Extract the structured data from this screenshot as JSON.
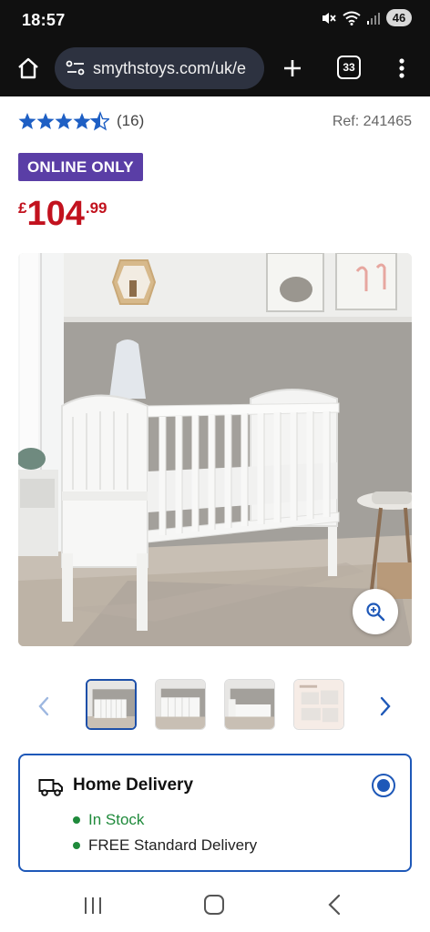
{
  "status_bar": {
    "time": "18:57",
    "battery": "46"
  },
  "browser": {
    "url": "smythstoys.com/uk/e",
    "tab_count": "33"
  },
  "product": {
    "rating": 4.5,
    "review_count": "(16)",
    "ref": "Ref: 241465",
    "badge": "ONLINE ONLY",
    "price_currency": "£",
    "price_main": "104",
    "price_pence": ".99"
  },
  "gallery": {
    "thumbnail_count": 4,
    "active_index": 0
  },
  "delivery": {
    "title": "Home Delivery",
    "stock": "In Stock",
    "free": "FREE Standard Delivery",
    "selected": true
  },
  "colors": {
    "star": "#1e5fc4",
    "badge": "#5a3ea6",
    "price": "#c2121e",
    "accent": "#1e58b8",
    "in_stock": "#1f8a3b"
  },
  "icons": {
    "home": "home-icon",
    "site_settings": "site-settings-icon",
    "new_tab": "plus-icon",
    "menu": "more-vert-icon",
    "zoom": "zoom-in-icon",
    "prev": "chevron-left-icon",
    "next": "chevron-right-icon",
    "delivery": "truck-icon"
  }
}
